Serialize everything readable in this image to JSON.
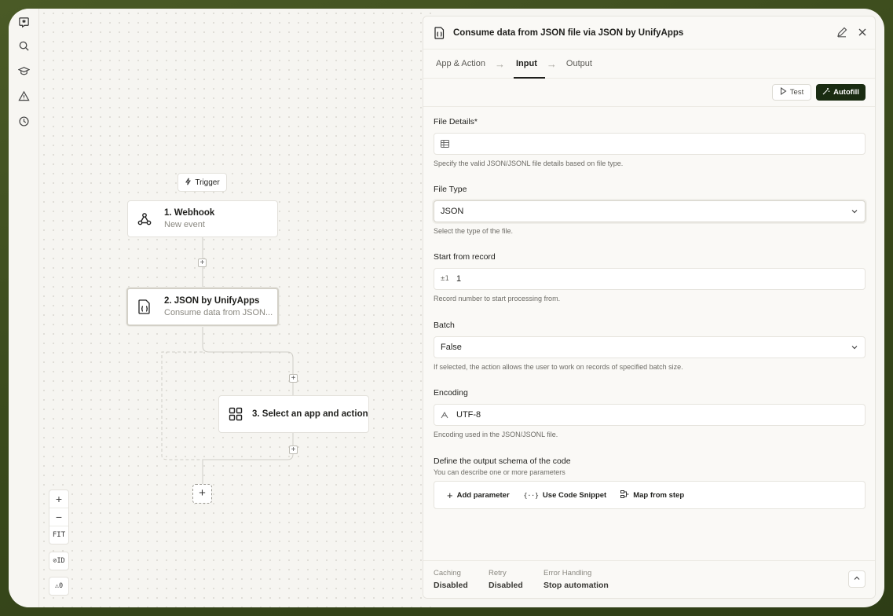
{
  "rail": {
    "items": [
      "logo-icon",
      "search-icon",
      "graduation-cap-icon",
      "warning-icon",
      "history-icon"
    ]
  },
  "canvas": {
    "trigger_label": "Trigger",
    "nodes": [
      {
        "title": "1. Webhook",
        "subtitle": "New event",
        "icon": "webhook-icon"
      },
      {
        "title": "2. JSON by UnifyApps",
        "subtitle": "Consume data from JSON...",
        "icon": "json-file-icon"
      },
      {
        "title": "3. Select an app and action",
        "subtitle": "",
        "icon": "grid-icon"
      }
    ],
    "controls": {
      "zoom_in": "+",
      "zoom_out": "−",
      "fit": "FIT",
      "id_toggle": "ID",
      "warnings": "0"
    }
  },
  "panel": {
    "title": "Consume data from JSON file via JSON by UnifyApps",
    "tabs": [
      {
        "label": "App & Action",
        "active": false
      },
      {
        "label": "Input",
        "active": true
      },
      {
        "label": "Output",
        "active": false
      }
    ],
    "test_label": "Test",
    "autofill_label": "Autofill",
    "fields": {
      "file_details": {
        "label": "File Details*",
        "value": "",
        "help": "Specify the valid JSON/JSONL file details based on file type."
      },
      "file_type": {
        "label": "File Type",
        "value": "JSON",
        "help": "Select the type of the file."
      },
      "start_record": {
        "label": "Start from record",
        "prefix": "±1",
        "value": "1",
        "help": "Record number to start processing from."
      },
      "batch": {
        "label": "Batch",
        "value": "False",
        "help": "If selected, the action allows the user to work on records of specified batch size."
      },
      "encoding": {
        "label": "Encoding",
        "value": "UTF-8",
        "help": "Encoding used in the JSON/JSONL file."
      }
    },
    "schema": {
      "title": "Define the output schema of the code",
      "subtitle": "You can describe one or more parameters",
      "add_parameter": "Add parameter",
      "code_snippet": "Use Code Snippet",
      "map_from_step": "Map from step"
    },
    "footer": {
      "caching": {
        "label": "Caching",
        "value": "Disabled"
      },
      "retry": {
        "label": "Retry",
        "value": "Disabled"
      },
      "error_handling": {
        "label": "Error Handling",
        "value": "Stop automation"
      }
    }
  },
  "colors": {
    "accent": "#1a2c12",
    "background": "#3f4f20"
  }
}
